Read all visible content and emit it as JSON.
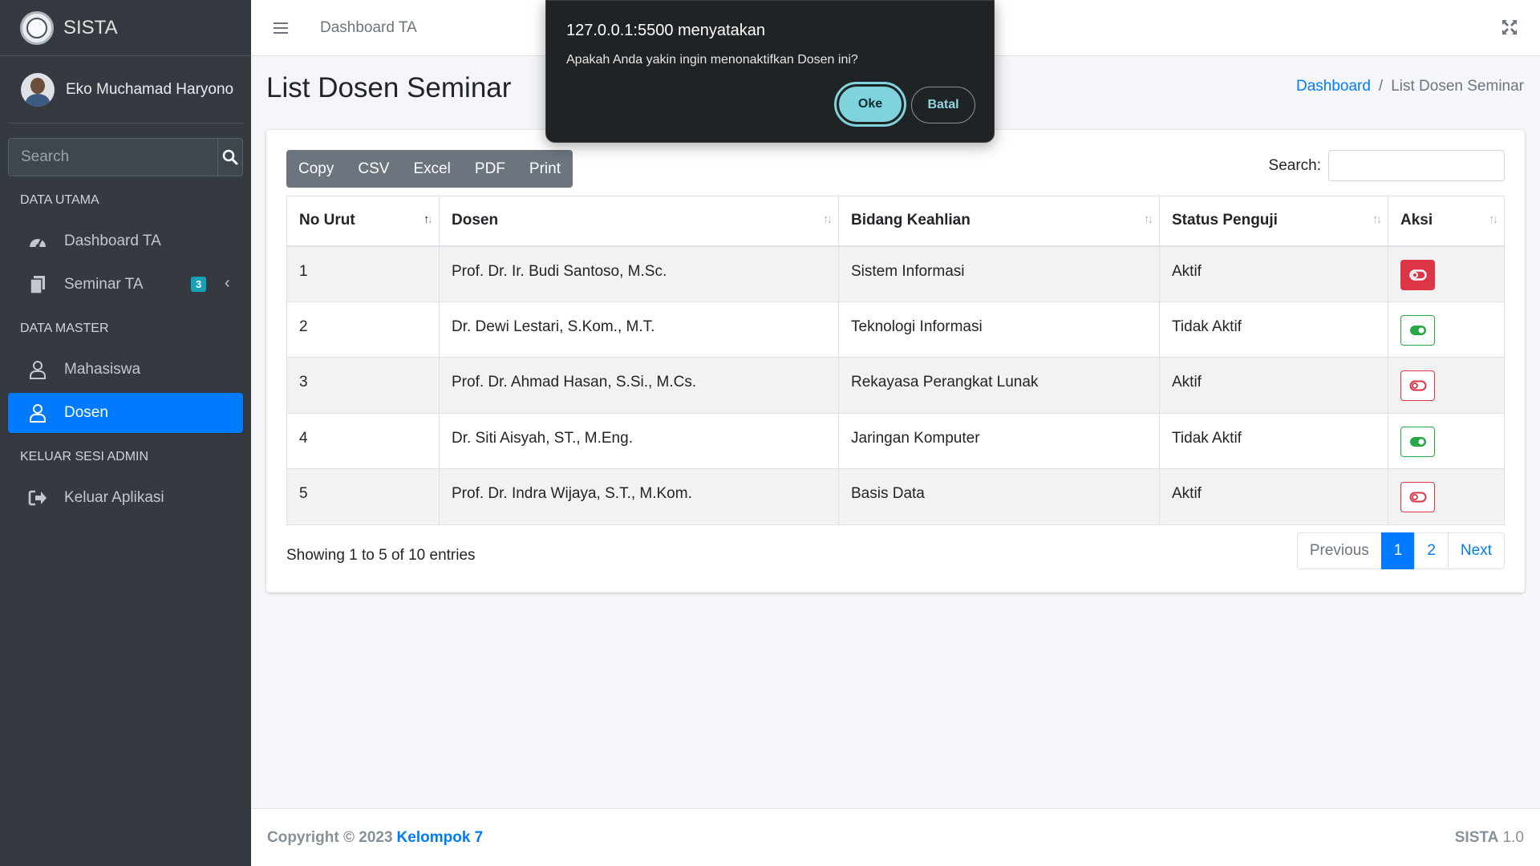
{
  "brand": {
    "name": "SISTA"
  },
  "user": {
    "name": "Eko Muchamad Haryono"
  },
  "sidebar": {
    "search_placeholder": "Search",
    "sections": [
      {
        "header": "DATA UTAMA"
      },
      {
        "header": "DATA MASTER"
      },
      {
        "header": "KELUAR SESI ADMIN"
      }
    ],
    "items": [
      {
        "label": "Dashboard TA",
        "icon": "tachometer-icon"
      },
      {
        "label": "Seminar TA",
        "icon": "copy-icon",
        "badge": "3"
      },
      {
        "label": "Mahasiswa",
        "icon": "user-icon"
      },
      {
        "label": "Dosen",
        "icon": "user-icon"
      },
      {
        "label": "Keluar Aplikasi",
        "icon": "sign-out-icon"
      }
    ]
  },
  "topbar": {
    "link": "Dashboard TA"
  },
  "page": {
    "title": "List Dosen Seminar",
    "breadcrumb": [
      "Dashboard",
      "/",
      "List Dosen Seminar"
    ]
  },
  "toolbar": {
    "buttons": [
      "Copy",
      "CSV",
      "Excel",
      "PDF",
      "Print"
    ],
    "search_label": "Search:"
  },
  "table": {
    "headers": [
      "No Urut",
      "Dosen",
      "Bidang Keahlian",
      "Status Penguji",
      "Aksi"
    ],
    "rows": [
      {
        "no": "1",
        "dosen": "Prof. Dr. Ir. Budi Santoso, M.Sc.",
        "bidang": "Sistem Informasi",
        "status": "Aktif"
      },
      {
        "no": "2",
        "dosen": "Dr. Dewi Lestari, S.Kom., M.T.",
        "bidang": "Teknologi Informasi",
        "status": "Tidak Aktif"
      },
      {
        "no": "3",
        "dosen": "Prof. Dr. Ahmad Hasan, S.Si., M.Cs.",
        "bidang": "Rekayasa Perangkat Lunak",
        "status": "Aktif"
      },
      {
        "no": "4",
        "dosen": "Dr. Siti Aisyah, ST., M.Eng.",
        "bidang": "Jaringan Komputer",
        "status": "Tidak Aktif"
      },
      {
        "no": "5",
        "dosen": "Prof. Dr. Indra Wijaya, S.T., M.Kom.",
        "bidang": "Basis Data",
        "status": "Aktif"
      }
    ]
  },
  "info": "Showing 1 to 5 of 10 entries",
  "pagination": [
    "Previous",
    "1",
    "2",
    "Next"
  ],
  "footer": {
    "copyright": "Copyright © 2023",
    "team": "Kelompok 7",
    "app": "SISTA",
    "version": "1.0"
  },
  "dialog": {
    "title": "127.0.0.1:5500 menyatakan",
    "message": "Apakah Anda yakin ingin menonaktifkan Dosen ini?",
    "ok": "Oke",
    "cancel": "Batal"
  },
  "colors": {
    "primary": "#007bff",
    "sidebar": "#343a40",
    "danger": "#dc3545",
    "success": "#28a745",
    "info": "#17a2b8"
  }
}
